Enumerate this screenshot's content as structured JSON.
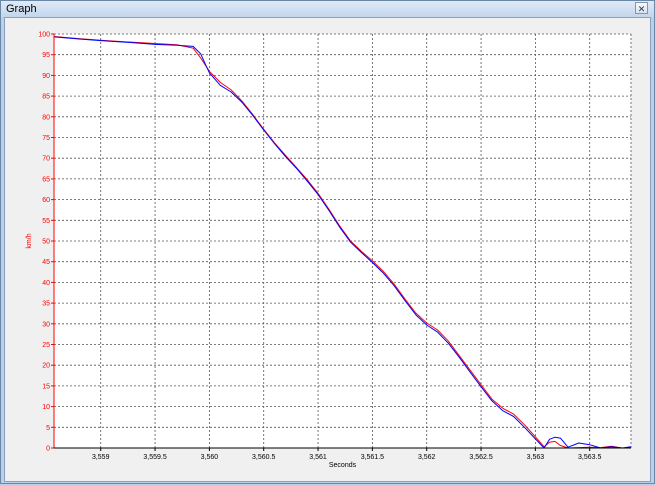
{
  "window": {
    "title": "Graph",
    "close_icon": "close-icon"
  },
  "chart_data": {
    "type": "line",
    "xlabel": "Seconds",
    "ylabel": "km/h",
    "xlim": [
      3558.57,
      3563.88
    ],
    "ylim": [
      0,
      100
    ],
    "x_ticks": [
      "3,559",
      "3,559.5",
      "3,560",
      "3,560.5",
      "3,561",
      "3,561.5",
      "3,562",
      "3,562.5",
      "3,563",
      "3,563.5"
    ],
    "x_tick_values": [
      3559,
      3559.5,
      3560,
      3560.5,
      3561,
      3561.5,
      3562,
      3562.5,
      3563,
      3563.5
    ],
    "y_ticks": [
      "0",
      "5",
      "10",
      "15",
      "20",
      "25",
      "30",
      "35",
      "40",
      "45",
      "50",
      "55",
      "60",
      "65",
      "70",
      "75",
      "80",
      "85",
      "90",
      "95",
      "100"
    ],
    "y_tick_values": [
      0,
      5,
      10,
      15,
      20,
      25,
      30,
      35,
      40,
      45,
      50,
      55,
      60,
      65,
      70,
      75,
      80,
      85,
      90,
      95,
      100
    ],
    "grid": true,
    "axis_color": "#ff0000",
    "series": [
      {
        "color": "#ff0000",
        "x": [
          3558.57,
          3558.8,
          3559,
          3559.3,
          3559.5,
          3559.7,
          3559.85,
          3559.92,
          3560,
          3560.1,
          3560.2,
          3560.3,
          3560.4,
          3560.5,
          3560.6,
          3560.7,
          3560.8,
          3560.9,
          3561,
          3561.1,
          3561.2,
          3561.3,
          3561.4,
          3561.5,
          3561.6,
          3561.7,
          3561.8,
          3561.9,
          3562,
          3562.1,
          3562.2,
          3562.3,
          3562.4,
          3562.5,
          3562.6,
          3562.7,
          3562.8,
          3562.9,
          3563.0,
          3563.08,
          3563.13,
          3563.18,
          3563.23,
          3563.3,
          3563.4,
          3563.5,
          3563.6,
          3563.7,
          3563.8,
          3563.88
        ],
        "y": [
          99.4,
          98.9,
          98.5,
          98.0,
          97.7,
          97.4,
          96.6,
          94.2,
          91.0,
          88.3,
          86.5,
          83.8,
          80.5,
          77.0,
          73.7,
          70.7,
          67.8,
          64.8,
          61.5,
          57.7,
          53.6,
          50.0,
          47.5,
          45.2,
          42.7,
          39.6,
          36.0,
          32.6,
          30.2,
          28.5,
          25.8,
          22.3,
          18.8,
          15.3,
          11.8,
          9.6,
          8.2,
          5.6,
          2.7,
          0.3,
          1.4,
          1.6,
          0.6,
          0.0,
          0.1,
          0.2,
          0.1,
          0.4,
          0.0,
          0.0
        ]
      },
      {
        "color": "#0000ff",
        "x": [
          3558.57,
          3558.8,
          3559,
          3559.3,
          3559.5,
          3559.7,
          3559.85,
          3559.92,
          3560,
          3560.1,
          3560.2,
          3560.3,
          3560.4,
          3560.5,
          3560.6,
          3560.7,
          3560.8,
          3560.9,
          3561,
          3561.1,
          3561.2,
          3561.3,
          3561.4,
          3561.5,
          3561.6,
          3561.7,
          3561.8,
          3561.9,
          3562,
          3562.1,
          3562.2,
          3562.3,
          3562.4,
          3562.5,
          3562.6,
          3562.7,
          3562.8,
          3562.9,
          3563.0,
          3563.08,
          3563.13,
          3563.18,
          3563.23,
          3563.3,
          3563.4,
          3563.5,
          3563.6,
          3563.7,
          3563.8,
          3563.88
        ],
        "y": [
          99.3,
          98.8,
          98.4,
          97.9,
          97.5,
          97.3,
          97.0,
          95.2,
          90.6,
          87.6,
          86.0,
          83.5,
          80.3,
          76.8,
          73.5,
          70.4,
          67.6,
          64.5,
          61.2,
          57.4,
          53.3,
          49.7,
          47.2,
          44.8,
          42.3,
          39.2,
          35.6,
          32.2,
          29.7,
          28.0,
          25.3,
          21.9,
          18.3,
          14.8,
          11.4,
          9.0,
          7.6,
          5.0,
          2.2,
          0.0,
          2.1,
          2.6,
          2.4,
          0.2,
          1.2,
          0.8,
          0.0,
          0.3,
          0.0,
          0.3
        ]
      }
    ]
  }
}
